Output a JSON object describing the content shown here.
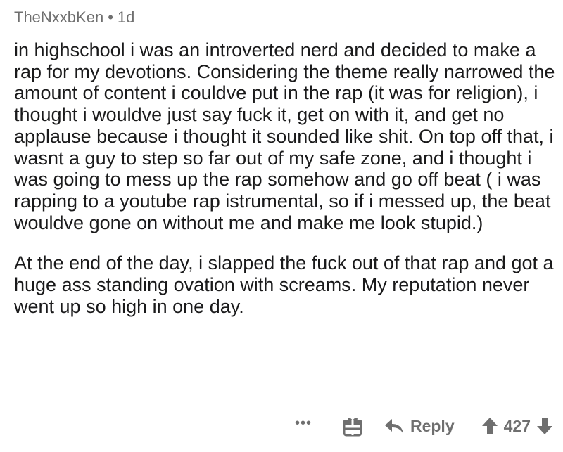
{
  "comment": {
    "author": "TheNxxbKen",
    "separator": "•",
    "age": "1d",
    "paragraphs": [
      "in highschool i was an introverted nerd and decided to make a rap for my devotions. Considering the theme really narrowed the amount of content i couldve put in the rap (it was for religion), i thought i wouldve just say fuck it, get on with it, and get no applause because i thought it sounded like shit. On top off that, i wasnt a guy to step so far out of my safe zone, and i thought i was going to mess up the rap somehow and go off beat ( i was rapping to a youtube rap istrumental, so if i messed up, the beat wouldve gone on without me and make me look stupid.)",
      "At the end of the day, i slapped the fuck out of that rap and got a huge ass standing ovation with screams. My reputation never went up so high in one day."
    ]
  },
  "actions": {
    "more": "•••",
    "reply_label": "Reply",
    "score": "427",
    "icons": [
      "more-options-icon",
      "award-icon",
      "reply-arrow-icon",
      "upvote-icon",
      "downvote-icon"
    ],
    "icon_color": "#6f6f6f"
  }
}
